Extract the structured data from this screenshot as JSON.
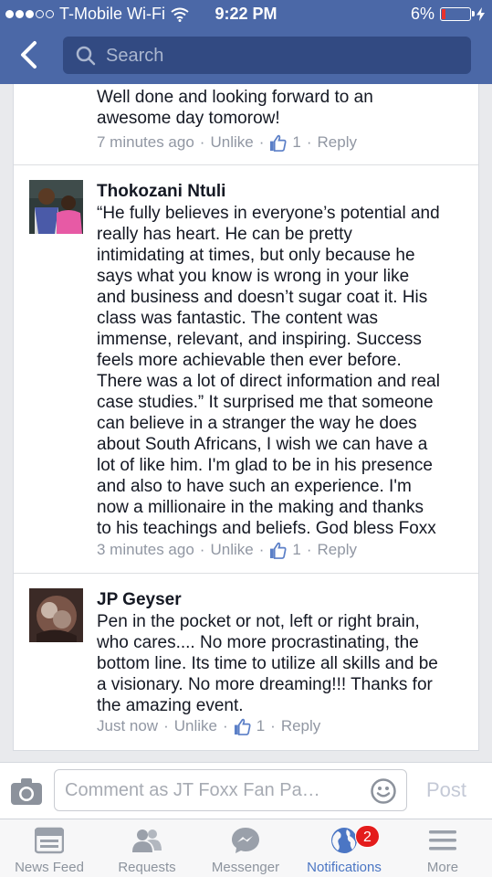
{
  "status_bar": {
    "carrier": "T-Mobile Wi-Fi",
    "time": "9:22 PM",
    "battery": "6%"
  },
  "search": {
    "placeholder": "Search"
  },
  "comments": [
    {
      "text": "Well done and looking forward to an\nawesome day tomorow!",
      "time": "7 minutes ago",
      "unlike": "Unlike",
      "likes": "1",
      "reply": "Reply"
    },
    {
      "author": "Thokozani Ntuli",
      "text": "“He fully believes in everyone’s potential and\nreally has heart. He can be pretty\nintimidating at times, but only because he\nsays what you know is wrong in your like\nand business and doesn’t sugar coat it. His\nclass was fantastic. The content was\nimmense, relevant, and inspiring. Success\nfeels more achievable then ever before.\nThere was a lot of direct information and real\ncase studies.” It surprised me that someone\ncan believe in a stranger the way he does\nabout South Africans, I wish we can have a\nlot of like him. I'm glad to be in his presence\nand also to have such an experience. I'm\nnow a millionaire in the making and thanks\nto his teachings and beliefs. God bless Foxx",
      "time": "3 minutes ago",
      "unlike": "Unlike",
      "likes": "1",
      "reply": "Reply"
    },
    {
      "author": "JP Geyser",
      "text": "Pen in the pocket or not, left or right brain,\nwho cares.... No more procrastinating, the\nbottom line. Its time to utilize all skills and be\na visionary. No more dreaming!!! Thanks for\nthe amazing event.",
      "time": "Just now",
      "unlike": "Unlike",
      "likes": "1",
      "reply": "Reply"
    }
  ],
  "composer": {
    "placeholder": "Comment as JT Foxx Fan Pa…",
    "post": "Post"
  },
  "tabs": [
    {
      "label": "News Feed",
      "icon": "news-feed-icon"
    },
    {
      "label": "Requests",
      "icon": "friend-requests-icon"
    },
    {
      "label": "Messenger",
      "icon": "messenger-icon"
    },
    {
      "label": "Notifications",
      "icon": "globe-icon",
      "badge": "2"
    },
    {
      "label": "More",
      "icon": "hamburger-icon"
    }
  ],
  "colors": {
    "header": "#4b68a7",
    "link": "#4b76c4",
    "meta": "#9197a3",
    "badge": "#e41c1c"
  }
}
